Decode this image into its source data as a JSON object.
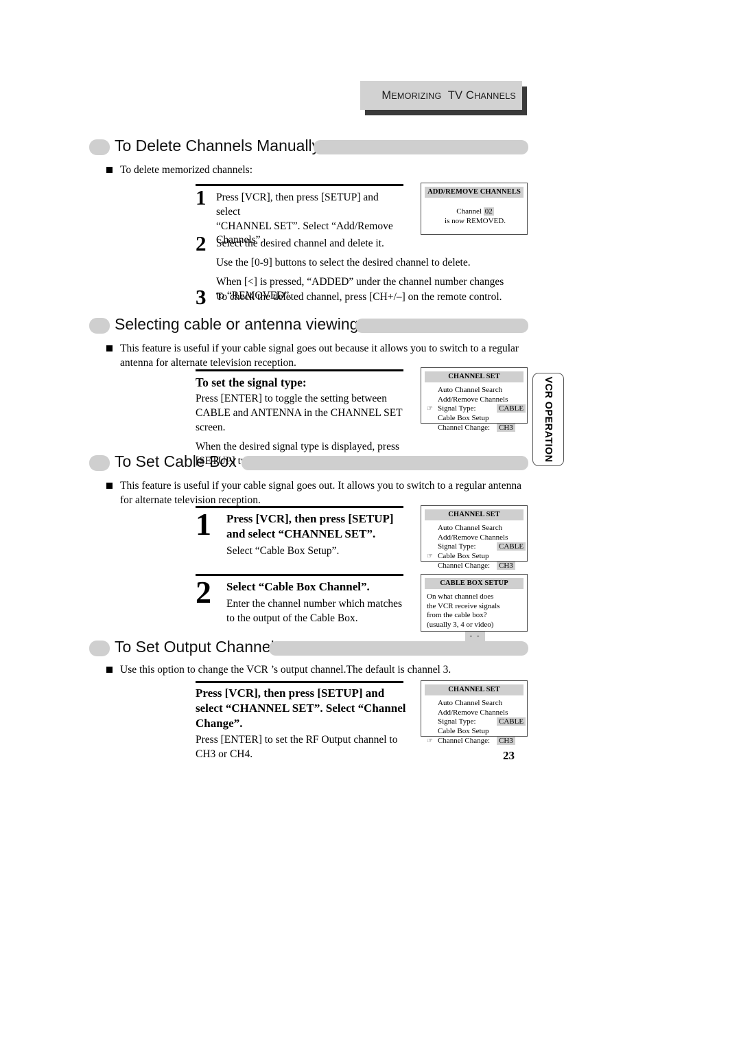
{
  "header": {
    "banner_main": "EMORIZING",
    "banner_first": "M",
    "banner_tv": "TV",
    "banner_c": "C",
    "banner_hannels": "HANNELS",
    "banner_full": "MEMORIZING  TV CHANNELS"
  },
  "page_number": "23",
  "side_tab": {
    "label": "VCR OPERATION"
  },
  "sections": [
    {
      "title": "To Delete Channels Manually",
      "intro": "To delete memorized channels:",
      "steps": [
        {
          "num": "1",
          "lines": [
            "Press [VCR], then press [SETUP] and select",
            "“CHANNEL SET”. Select “Add/Remove",
            "Channels”."
          ]
        },
        {
          "num": "2",
          "lines": [
            "Select the desired channel and delete it."
          ],
          "extra": [
            "Use the [0-9] buttons to select the desired channel to delete.",
            "When [<] is pressed, “ADDED” under the channel number changes to “REMOVED”."
          ]
        },
        {
          "num": "3",
          "lines": [
            "To check the deleted channel, press [CH+/–] on the remote control."
          ]
        }
      ]
    },
    {
      "title": "Selecting cable or antenna viewing",
      "intro": "This feature is useful if your cable signal goes out because it allows you to switch to a regular antenna for alternate television reception.",
      "subhead": "To set the signal type:",
      "paragraphs": [
        "Press [ENTER] to toggle the setting between CABLE and ANTENNA  in the CHANNEL SET screen.",
        "When the desired signal type is displayed, press [SETUP] twice to exit."
      ]
    },
    {
      "title": "To Set Cable Box",
      "intro": "This feature is useful if your cable signal goes out. It allows you to switch to a regular antenna for alternate television reception.",
      "steps": [
        {
          "num": "1",
          "lead": "Press [VCR], then press [SETUP]  and select “CHANNEL SET”.",
          "sub": "Select “Cable Box Setup”."
        },
        {
          "num": "2",
          "lead": "Select “Cable Box Channel”.",
          "sub": "Enter the channel number which matches to the output of the Cable Box."
        }
      ]
    },
    {
      "title": "To Set Output Channel",
      "intro": "Use this option to change the VCR ’s output channel.The default is channel 3.",
      "lead": "Press [VCR], then press [SETUP] and select “CHANNEL SET”. Select “Channel Change”.",
      "sub": "Press [ENTER] to set the RF Output channel to CH3 or CH4."
    }
  ],
  "osd": {
    "add_remove": {
      "title": "ADD/REMOVE CHANNELS",
      "line1_pre": "Channel ",
      "line1_val": "02",
      "line2": "is now REMOVED."
    },
    "channel_set_signal": {
      "title": "CHANNEL SET",
      "rows": [
        {
          "cursor": "",
          "label": "Auto Channel Search",
          "value": ""
        },
        {
          "cursor": "",
          "label": "Add/Remove Channels",
          "value": ""
        },
        {
          "cursor": "☞",
          "label": "Signal Type:",
          "value": "CABLE"
        },
        {
          "cursor": "",
          "label": "Cable Box Setup",
          "value": ""
        },
        {
          "cursor": "",
          "label": "Channel Change:",
          "value": "CH3"
        }
      ]
    },
    "channel_set_cablebox": {
      "title": "CHANNEL SET",
      "rows": [
        {
          "cursor": "",
          "label": "Auto Channel Search",
          "value": ""
        },
        {
          "cursor": "",
          "label": "Add/Remove Channels",
          "value": ""
        },
        {
          "cursor": "",
          "label": "Signal Type:",
          "value": "CABLE"
        },
        {
          "cursor": "☞",
          "label": "Cable Box Setup",
          "value": ""
        },
        {
          "cursor": "",
          "label": "Channel Change:",
          "value": "CH3"
        }
      ]
    },
    "cable_box_setup": {
      "title": "CABLE BOX SETUP",
      "lines": [
        "On what channel does",
        "the VCR receive signals",
        "from the cable box?",
        "(usually 3, 4 or video)"
      ],
      "value": "- -"
    },
    "channel_set_change": {
      "title": "CHANNEL SET",
      "rows": [
        {
          "cursor": "",
          "label": "Auto Channel Search",
          "value": ""
        },
        {
          "cursor": "",
          "label": "Add/Remove Channels",
          "value": ""
        },
        {
          "cursor": "",
          "label": "Signal Type:",
          "value": "CABLE"
        },
        {
          "cursor": "",
          "label": "Cable Box Setup",
          "value": ""
        },
        {
          "cursor": "☞",
          "label": "Channel Change:",
          "value": "CH3"
        }
      ]
    }
  },
  "colors": {
    "gray_fill": "#cfcfcf",
    "banner_shadow": "#3a3a3a",
    "text": "#000000"
  }
}
